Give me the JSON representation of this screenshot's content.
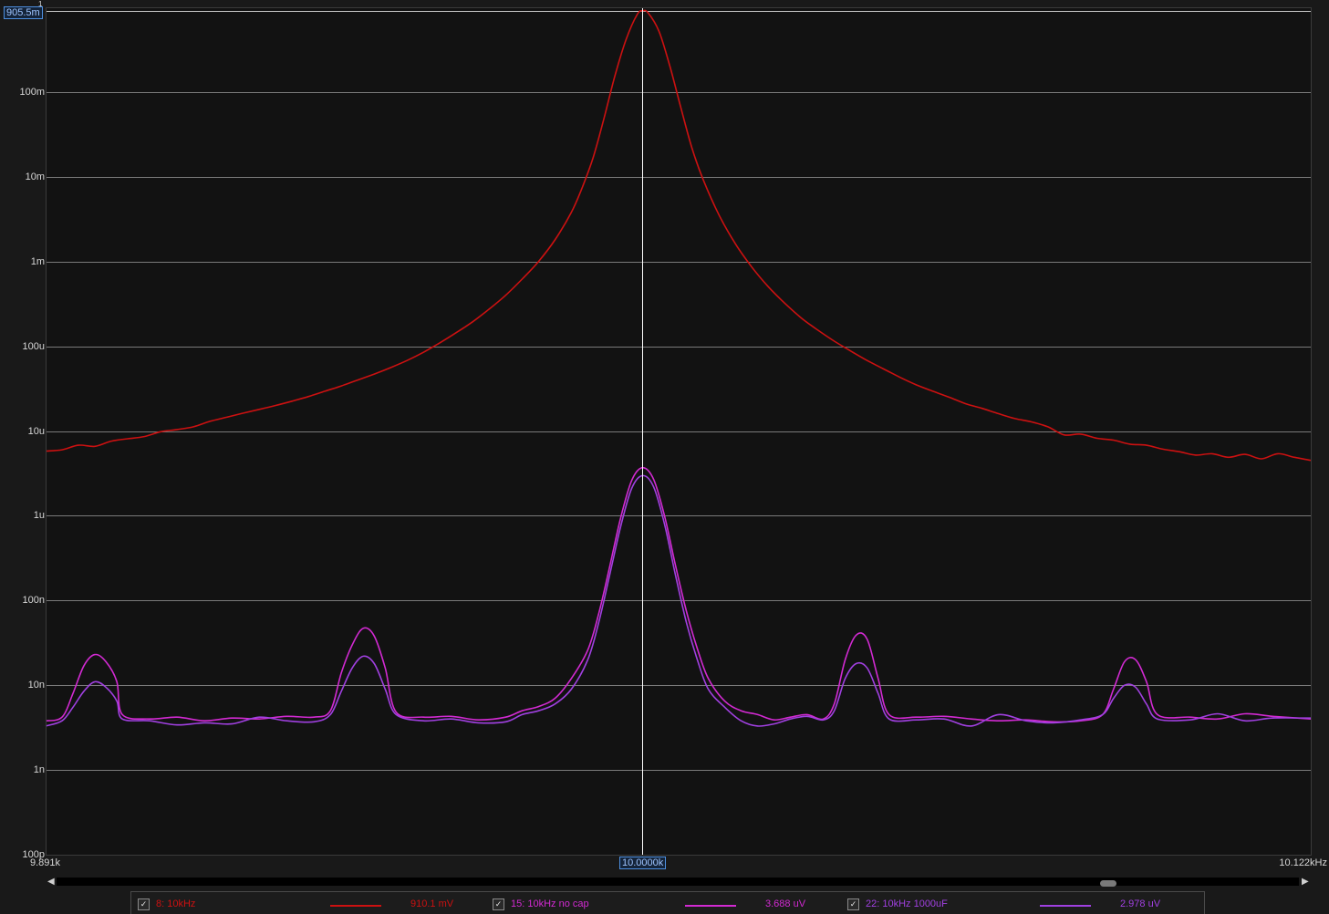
{
  "y_axis": {
    "ticks": [
      {
        "label": "905.5m",
        "value": 0.9055,
        "cursor": true
      },
      {
        "label": "100m",
        "value": 0.1
      },
      {
        "label": "10m",
        "value": 0.01
      },
      {
        "label": "1m",
        "value": 0.001
      },
      {
        "label": "100u",
        "value": 0.0001
      },
      {
        "label": "10u",
        "value": 1e-05
      },
      {
        "label": "1u",
        "value": 1e-06
      },
      {
        "label": "100n",
        "value": 1e-07
      },
      {
        "label": "10n",
        "value": 1e-08
      },
      {
        "label": "1n",
        "value": 1e-09
      },
      {
        "label": "100p",
        "value": 1e-10
      }
    ],
    "top_marker": "1"
  },
  "x_axis": {
    "start_label": "9.891k",
    "cursor_label": "10.0000k",
    "end_label": "10.122kHz"
  },
  "legend": [
    {
      "checked": true,
      "name": "8: 10kHz",
      "value": "910.1 mV",
      "color": "#cc1111"
    },
    {
      "checked": true,
      "name": "15: 10kHz no cap",
      "value": "3.688 uV",
      "color": "#d22ad2"
    },
    {
      "checked": true,
      "name": "22: 10kHz 1000uF",
      "value": "2.978 uV",
      "color": "#a040e0"
    }
  ],
  "colors": {
    "background": "#121212",
    "grid": "#7a7a7a",
    "cursor": "#ffffff",
    "accent": "#4d8fe0"
  },
  "chart_data": {
    "type": "line",
    "x_scale": "linear",
    "y_scale": "log",
    "xlim": [
      9891,
      10122
    ],
    "ylim": [
      1e-10,
      1.0
    ],
    "x_unit": "Hz",
    "y_unit": "V",
    "cursor_x": 10000,
    "grid": true,
    "series": [
      {
        "name": "8: 10kHz",
        "color": "#cc1111",
        "points": [
          [
            9891.0,
            5.8e-06
          ],
          [
            9894.0,
            6e-06
          ],
          [
            9897.0,
            6.8e-06
          ],
          [
            9900.0,
            6.6e-06
          ],
          [
            9903.0,
            7.6e-06
          ],
          [
            9906.0,
            8.1e-06
          ],
          [
            9909.0,
            8.6e-06
          ],
          [
            9912.0,
            9.8e-06
          ],
          [
            9915.0,
            1.04e-05
          ],
          [
            9918.0,
            1.12e-05
          ],
          [
            9921.0,
            1.3e-05
          ],
          [
            9924.0,
            1.45e-05
          ],
          [
            9927.0,
            1.62e-05
          ],
          [
            9930.0,
            1.8e-05
          ],
          [
            9933.0,
            2e-05
          ],
          [
            9936.0,
            2.25e-05
          ],
          [
            9939.0,
            2.55e-05
          ],
          [
            9942.0,
            2.95e-05
          ],
          [
            9945.0,
            3.4e-05
          ],
          [
            9948.0,
            4e-05
          ],
          [
            9951.0,
            4.7e-05
          ],
          [
            9954.0,
            5.6e-05
          ],
          [
            9957.0,
            6.8e-05
          ],
          [
            9960.0,
            8.5e-05
          ],
          [
            9963.0,
            0.00011
          ],
          [
            9966.0,
            0.000145
          ],
          [
            9969.0,
            0.000195
          ],
          [
            9972.0,
            0.000275
          ],
          [
            9975.0,
            0.0004
          ],
          [
            9978.0,
            0.00062
          ],
          [
            9981.0,
            0.001
          ],
          [
            9984.0,
            0.0018
          ],
          [
            9987.0,
            0.0038
          ],
          [
            9989.0,
            0.0075
          ],
          [
            9991.0,
            0.017
          ],
          [
            9993.0,
            0.05
          ],
          [
            9995.0,
            0.16
          ],
          [
            9997.0,
            0.42
          ],
          [
            9999.0,
            0.82
          ],
          [
            10000.0,
            0.9101
          ],
          [
            10001.0,
            0.86
          ],
          [
            10003.0,
            0.52
          ],
          [
            10005.0,
            0.2
          ],
          [
            10007.0,
            0.065
          ],
          [
            10009.0,
            0.022
          ],
          [
            10011.0,
            0.0095
          ],
          [
            10014.0,
            0.0035
          ],
          [
            10017.0,
            0.0016
          ],
          [
            10020.0,
            0.00085
          ],
          [
            10023.0,
            0.0005
          ],
          [
            10026.0,
            0.00032
          ],
          [
            10029.0,
            0.000215
          ],
          [
            10032.0,
            0.000155
          ],
          [
            10035.0,
            0.000115
          ],
          [
            10038.0,
            8.8e-05
          ],
          [
            10041.0,
            6.8e-05
          ],
          [
            10044.0,
            5.4e-05
          ],
          [
            10047.0,
            4.3e-05
          ],
          [
            10050.0,
            3.5e-05
          ],
          [
            10053.0,
            2.95e-05
          ],
          [
            10056.0,
            2.5e-05
          ],
          [
            10059.0,
            2.1e-05
          ],
          [
            10062.0,
            1.85e-05
          ],
          [
            10065.0,
            1.6e-05
          ],
          [
            10068.0,
            1.4e-05
          ],
          [
            10071.0,
            1.28e-05
          ],
          [
            10074.0,
            1.12e-05
          ],
          [
            10077.0,
            9e-06
          ],
          [
            10080.0,
            9.2e-06
          ],
          [
            10083.0,
            8.2e-06
          ],
          [
            10086.0,
            7.8e-06
          ],
          [
            10089.0,
            7e-06
          ],
          [
            10092.0,
            6.8e-06
          ],
          [
            10095.0,
            6.1e-06
          ],
          [
            10098.0,
            5.7e-06
          ],
          [
            10101.0,
            5.2e-06
          ],
          [
            10104.0,
            5.4e-06
          ],
          [
            10107.0,
            4.9e-06
          ],
          [
            10110.0,
            5.3e-06
          ],
          [
            10113.0,
            4.7e-06
          ],
          [
            10116.0,
            5.4e-06
          ],
          [
            10119.0,
            4.9e-06
          ],
          [
            10122.0,
            4.5e-06
          ]
        ]
      },
      {
        "name": "15: 10kHz no cap",
        "color": "#d22ad2",
        "points": [
          [
            9891.0,
            3.8e-09
          ],
          [
            9894.0,
            4.2e-09
          ],
          [
            9896.0,
            8e-09
          ],
          [
            9898.0,
            1.7e-08
          ],
          [
            9900.0,
            2.3e-08
          ],
          [
            9902.0,
            1.9e-08
          ],
          [
            9904.0,
            1.1e-08
          ],
          [
            9905.0,
            4.5e-09
          ],
          [
            9910.0,
            4e-09
          ],
          [
            9915.0,
            4.2e-09
          ],
          [
            9920.0,
            3.8e-09
          ],
          [
            9925.0,
            4.1e-09
          ],
          [
            9930.0,
            4e-09
          ],
          [
            9935.0,
            4.3e-09
          ],
          [
            9940.0,
            4.2e-09
          ],
          [
            9943.0,
            5e-09
          ],
          [
            9945.0,
            1.4e-08
          ],
          [
            9947.0,
            3e-08
          ],
          [
            9949.0,
            4.7e-08
          ],
          [
            9951.0,
            3.8e-08
          ],
          [
            9953.0,
            1.6e-08
          ],
          [
            9955.0,
            4.8e-09
          ],
          [
            9960.0,
            4.2e-09
          ],
          [
            9965.0,
            4.3e-09
          ],
          [
            9970.0,
            3.9e-09
          ],
          [
            9975.0,
            4.2e-09
          ],
          [
            9978.0,
            5e-09
          ],
          [
            9981.0,
            5.6e-09
          ],
          [
            9984.0,
            7e-09
          ],
          [
            9987.0,
            1.2e-08
          ],
          [
            9990.0,
            2.6e-08
          ],
          [
            9992.0,
            7e-08
          ],
          [
            9994.0,
            2.5e-07
          ],
          [
            9996.0,
            9.5e-07
          ],
          [
            9998.0,
            2.6e-06
          ],
          [
            10000.0,
            3.688e-06
          ],
          [
            10002.0,
            2.7e-06
          ],
          [
            10004.0,
            1e-06
          ],
          [
            10006.0,
            2.6e-07
          ],
          [
            10008.0,
            7.5e-08
          ],
          [
            10010.0,
            2.7e-08
          ],
          [
            10012.0,
            1.2e-08
          ],
          [
            10015.0,
            6.5e-09
          ],
          [
            10018.0,
            5e-09
          ],
          [
            10021.0,
            4.5e-09
          ],
          [
            10024.0,
            3.9e-09
          ],
          [
            10027.0,
            4.2e-09
          ],
          [
            10030.0,
            4.5e-09
          ],
          [
            10033.0,
            4e-09
          ],
          [
            10035.0,
            6e-09
          ],
          [
            10037.0,
            2e-08
          ],
          [
            10039.0,
            3.9e-08
          ],
          [
            10041.0,
            3.5e-08
          ],
          [
            10043.0,
            1.2e-08
          ],
          [
            10045.0,
            4.5e-09
          ],
          [
            10050.0,
            4.2e-09
          ],
          [
            10055.0,
            4.3e-09
          ],
          [
            10060.0,
            4e-09
          ],
          [
            10065.0,
            3.8e-09
          ],
          [
            10070.0,
            3.9e-09
          ],
          [
            10075.0,
            3.7e-09
          ],
          [
            10080.0,
            3.8e-09
          ],
          [
            10084.0,
            4.5e-09
          ],
          [
            10086.0,
            9e-09
          ],
          [
            10088.0,
            1.9e-08
          ],
          [
            10090.0,
            2e-08
          ],
          [
            10092.0,
            1.1e-08
          ],
          [
            10094.0,
            4.5e-09
          ],
          [
            10100.0,
            4.2e-09
          ],
          [
            10105.0,
            4e-09
          ],
          [
            10110.0,
            4.6e-09
          ],
          [
            10115.0,
            4.3e-09
          ],
          [
            10122.0,
            4e-09
          ]
        ]
      },
      {
        "name": "22: 10kHz 1000uF",
        "color": "#a040e0",
        "points": [
          [
            9891.0,
            3.3e-09
          ],
          [
            9894.0,
            3.8e-09
          ],
          [
            9896.0,
            5.5e-09
          ],
          [
            9898.0,
            8.5e-09
          ],
          [
            9900.0,
            1.1e-08
          ],
          [
            9902.0,
            9.5e-09
          ],
          [
            9904.0,
            6.5e-09
          ],
          [
            9905.0,
            4e-09
          ],
          [
            9910.0,
            3.8e-09
          ],
          [
            9915.0,
            3.4e-09
          ],
          [
            9920.0,
            3.6e-09
          ],
          [
            9925.0,
            3.5e-09
          ],
          [
            9930.0,
            4.2e-09
          ],
          [
            9935.0,
            3.8e-09
          ],
          [
            9940.0,
            3.7e-09
          ],
          [
            9943.0,
            4.5e-09
          ],
          [
            9945.0,
            8.5e-09
          ],
          [
            9947.0,
            1.6e-08
          ],
          [
            9949.0,
            2.2e-08
          ],
          [
            9951.0,
            1.8e-08
          ],
          [
            9953.0,
            9e-09
          ],
          [
            9955.0,
            4.5e-09
          ],
          [
            9960.0,
            3.8e-09
          ],
          [
            9965.0,
            4e-09
          ],
          [
            9970.0,
            3.6e-09
          ],
          [
            9975.0,
            3.7e-09
          ],
          [
            9978.0,
            4.5e-09
          ],
          [
            9981.0,
            5e-09
          ],
          [
            9984.0,
            6e-09
          ],
          [
            9987.0,
            9e-09
          ],
          [
            9990.0,
            2e-08
          ],
          [
            9992.0,
            5.5e-08
          ],
          [
            9994.0,
            2e-07
          ],
          [
            9996.0,
            7.5e-07
          ],
          [
            9998.0,
            2.1e-06
          ],
          [
            10000.0,
            2.978e-06
          ],
          [
            10002.0,
            2.2e-06
          ],
          [
            10004.0,
            8e-07
          ],
          [
            10006.0,
            2e-07
          ],
          [
            10008.0,
            5.5e-08
          ],
          [
            10010.0,
            2e-08
          ],
          [
            10012.0,
            9e-09
          ],
          [
            10015.0,
            5.5e-09
          ],
          [
            10018.0,
            3.8e-09
          ],
          [
            10021.0,
            3.3e-09
          ],
          [
            10024.0,
            3.5e-09
          ],
          [
            10027.0,
            4e-09
          ],
          [
            10030.0,
            4.3e-09
          ],
          [
            10033.0,
            3.9e-09
          ],
          [
            10035.0,
            5e-09
          ],
          [
            10037.0,
            1.2e-08
          ],
          [
            10039.0,
            1.8e-08
          ],
          [
            10041.0,
            1.6e-08
          ],
          [
            10043.0,
            8e-09
          ],
          [
            10045.0,
            4e-09
          ],
          [
            10050.0,
            3.9e-09
          ],
          [
            10055.0,
            4e-09
          ],
          [
            10060.0,
            3.3e-09
          ],
          [
            10065.0,
            4.5e-09
          ],
          [
            10070.0,
            3.8e-09
          ],
          [
            10075.0,
            3.6e-09
          ],
          [
            10080.0,
            3.9e-09
          ],
          [
            10084.0,
            4.5e-09
          ],
          [
            10086.0,
            7e-09
          ],
          [
            10088.0,
            1e-08
          ],
          [
            10090.0,
            9.5e-09
          ],
          [
            10092.0,
            6e-09
          ],
          [
            10094.0,
            4e-09
          ],
          [
            10100.0,
            3.9e-09
          ],
          [
            10105.0,
            4.6e-09
          ],
          [
            10110.0,
            3.8e-09
          ],
          [
            10115.0,
            4.1e-09
          ],
          [
            10122.0,
            4.1e-09
          ]
        ]
      }
    ]
  }
}
